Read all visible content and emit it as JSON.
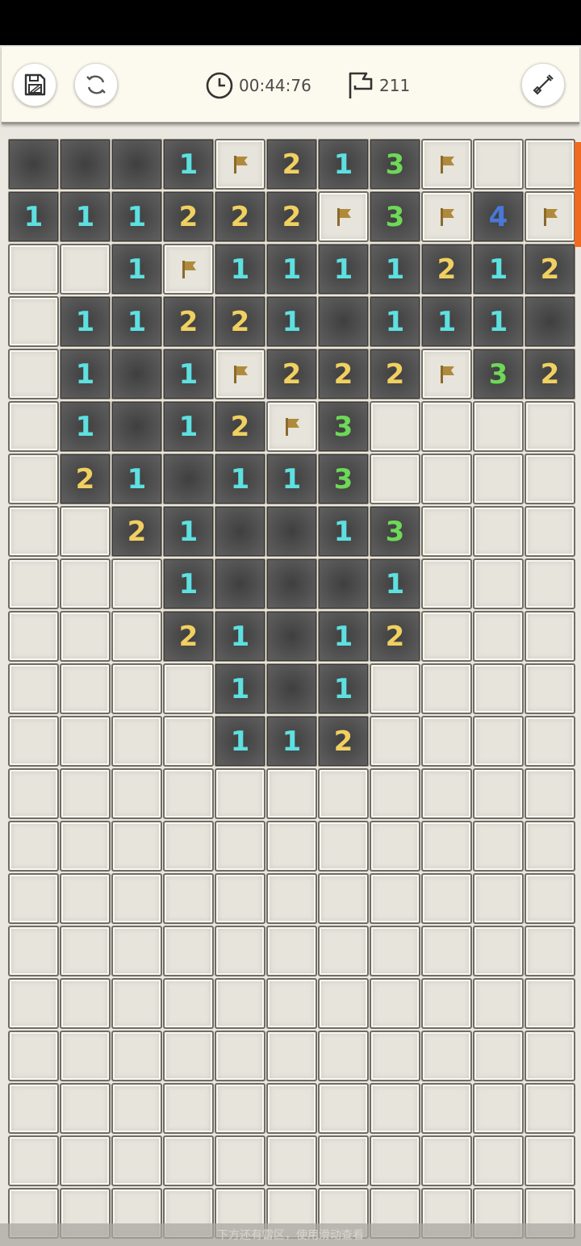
{
  "header": {
    "timer": "00:44:76",
    "flags_left": "211"
  },
  "colors": {
    "1": "#5ee0e0",
    "2": "#f0d060",
    "3": "#6ed858",
    "4": "#4a78d8",
    "flag": "#b08a3c"
  },
  "icons": [
    "save-icon",
    "refresh-icon",
    "clock-icon",
    "flag-icon",
    "shovel-icon"
  ],
  "board": {
    "cols": 11,
    "rows": [
      "OOO1F213F##",
      "11122 2F3F4F",
      "##1F1111212",
      "#11221O111O",
      "#1O1F222F32",
      "#1O12F3####",
      "#21O113####",
      "##21OO13###",
      "###1OOO1###",
      "###21O12###",
      "####1O1####",
      "####112####",
      "###########",
      "###########",
      "###########",
      "###########",
      "###########",
      "###########",
      "###########",
      "###########",
      "###########"
    ]
  },
  "footer": {
    "hint": "下方还有雷区，使用滑动查看"
  }
}
